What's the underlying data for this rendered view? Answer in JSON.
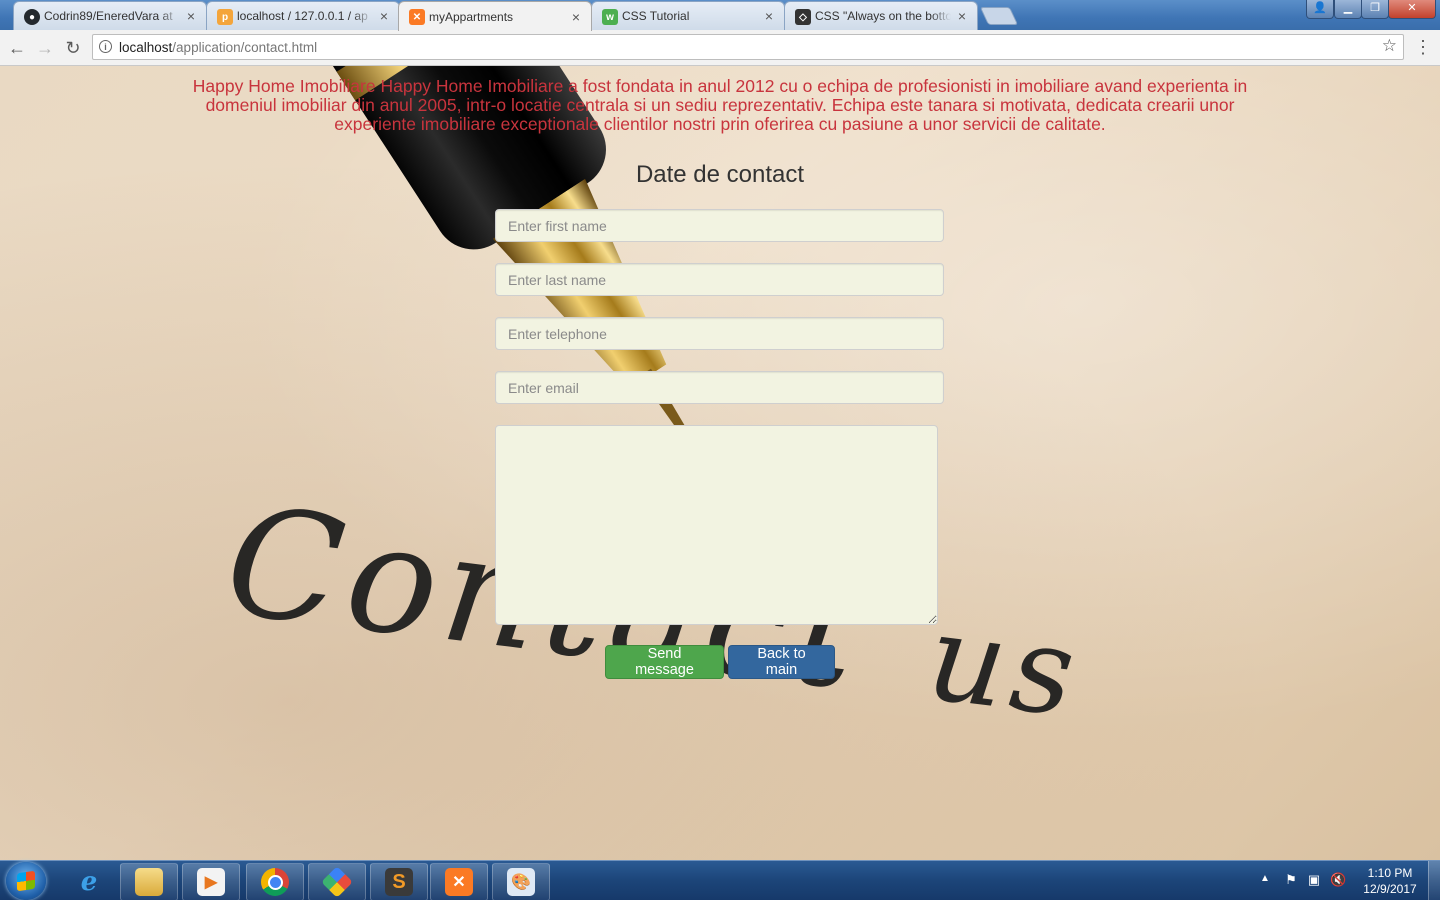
{
  "browser": {
    "tabs": [
      {
        "title": "Codrin89/EneredVara at",
        "icon": "github-icon",
        "icon_color": "#24292e",
        "active": false
      },
      {
        "title": "localhost / 127.0.0.1 / ap",
        "icon": "phpmyadmin-icon",
        "icon_color": "#f4a53b",
        "active": false
      },
      {
        "title": "myAppartments",
        "icon": "xampp-icon",
        "icon_color": "#fb7a24",
        "active": true
      },
      {
        "title": "CSS Tutorial",
        "icon": "w3schools-icon",
        "icon_color": "#4caf50",
        "active": false
      },
      {
        "title": "CSS \"Always on the botto",
        "icon": "codepen-icon",
        "icon_color": "#333333",
        "active": false
      }
    ],
    "url_host": "localhost",
    "url_path": "/application/contact.html"
  },
  "page": {
    "intro": "Happy Home Imobiliare Happy Home Imobiliare a fost fondata in anul 2012 cu o echipa de profesionisti in imobiliare avand experienta in domeniul imobiliar din anul 2005, intr-o locatie centrala si un sediu reprezentativ. Echipa este tanara si motivata, dedicata crearii unor experiente imobiliare exceptionale clientilor nostri prin oferirea cu pasiune a unor servicii de calitate.",
    "intro_color": "#c8343d",
    "background_text_1": "Contact",
    "background_text_2": "us",
    "form": {
      "title": "Date de contact",
      "first_name_placeholder": "Enter first name",
      "last_name_placeholder": "Enter last name",
      "telephone_placeholder": "Enter telephone",
      "email_placeholder": "Enter email",
      "message_value": "",
      "send_label": "Send message",
      "back_label": "Back to main",
      "send_color": "#4ea64c",
      "back_color": "#33679e"
    }
  },
  "taskbar": {
    "apps": [
      "internet-explorer-icon",
      "file-explorer-icon",
      "media-player-icon",
      "chrome-icon",
      "app-icon",
      "sublime-text-icon",
      "xampp-icon",
      "paint-icon"
    ],
    "clock_time": "1:10 PM",
    "clock_date": "12/9/2017"
  }
}
